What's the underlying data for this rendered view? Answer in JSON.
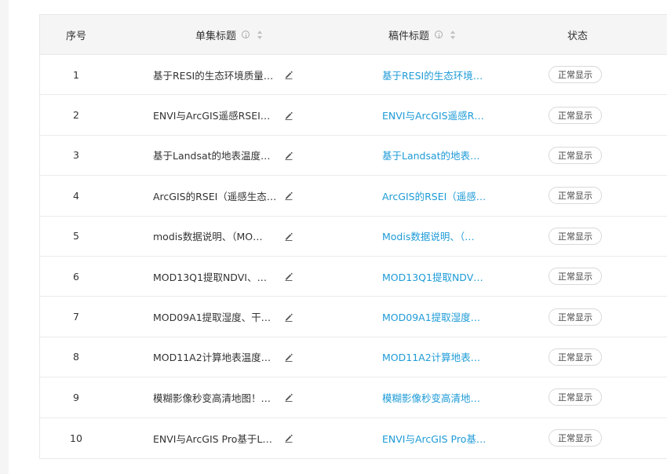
{
  "table": {
    "headers": {
      "index": "序号",
      "episode_title": "单集标题",
      "manuscript_title": "稿件标题",
      "status": "状态"
    },
    "rows": [
      {
        "index": "1",
        "episode_title": "基于RESI的生态环境质量…",
        "manuscript_title": "基于RESI的生态环境…",
        "status": "正常显示"
      },
      {
        "index": "2",
        "episode_title": "ENVI与ArcGIS遥感RSEI…",
        "manuscript_title": "ENVI与ArcGIS遥感R…",
        "status": "正常显示"
      },
      {
        "index": "3",
        "episode_title": "基于Landsat的地表温度…",
        "manuscript_title": "基于Landsat的地表…",
        "status": "正常显示"
      },
      {
        "index": "4",
        "episode_title": "ArcGIS的RSEI（遥感生态…",
        "manuscript_title": "ArcGIS的RSEI（遥感…",
        "status": "正常显示"
      },
      {
        "index": "5",
        "episode_title": "modis数据说明、（MO…",
        "manuscript_title": "Modis数据说明、（…",
        "status": "正常显示"
      },
      {
        "index": "6",
        "episode_title": "MOD13Q1提取NDVI、…",
        "manuscript_title": "MOD13Q1提取NDV…",
        "status": "正常显示"
      },
      {
        "index": "7",
        "episode_title": "MOD09A1提取湿度、干…",
        "manuscript_title": "MOD09A1提取湿度…",
        "status": "正常显示"
      },
      {
        "index": "8",
        "episode_title": "MOD11A2计算地表温度…",
        "manuscript_title": "MOD11A2计算地表…",
        "status": "正常显示"
      },
      {
        "index": "9",
        "episode_title": "模糊影像秒变高清地图！…",
        "manuscript_title": "模糊影像秒变高清地…",
        "status": "正常显示"
      },
      {
        "index": "10",
        "episode_title": "ENVI与ArcGIS Pro基于L…",
        "manuscript_title": "ENVI与ArcGIS Pro基…",
        "status": "正常显示"
      }
    ]
  },
  "colors": {
    "link": "#1e9bd7",
    "header_bg": "#f5f5f5",
    "border": "#e8e8e8"
  },
  "icons": {
    "header": [
      "info-icon",
      "sort-icon"
    ],
    "row": "edit-pencil-icon"
  }
}
